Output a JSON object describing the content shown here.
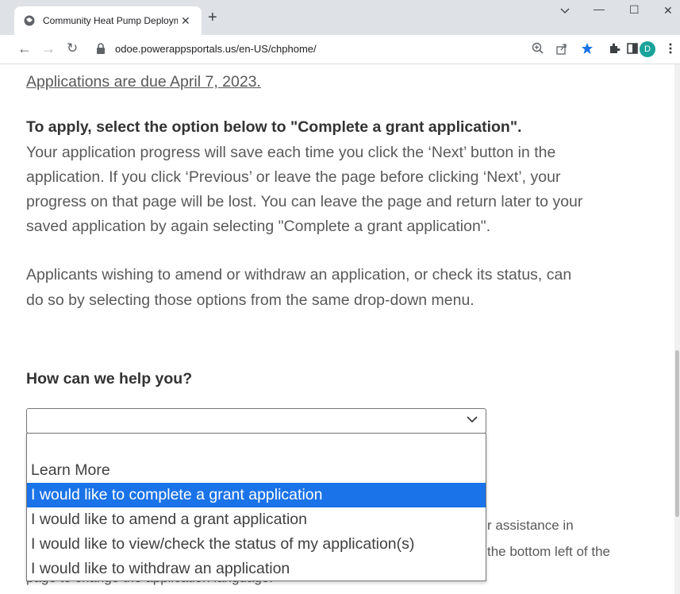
{
  "browser": {
    "tab_title": "Community Heat Pump Deploym",
    "tab_close": "✕",
    "new_tab": "+",
    "win_min": "—",
    "win_max": "☐",
    "win_close": "✕",
    "url": "odoe.powerappsportals.us/en-US/chphome/",
    "avatar_letter": "D"
  },
  "page": {
    "due_text": "Applications are due April 7, 2023.",
    "apply_heading": "To apply, select the option below to \"Complete a grant application\".",
    "apply_line1": "Your application progress will save each time you click the ‘Next’ button in the",
    "apply_line2": "application. If you click ‘Previous’ or leave the page before clicking ‘Next’, your",
    "apply_line3": "progress on that page will be lost. You can leave the page and return later to your",
    "apply_line4": "saved application by again selecting \"Complete a grant application\".",
    "amend_line1": "Applicants wishing to amend or withdraw an application, or check its status, can",
    "amend_line2": "do so by selecting those options from the same drop-down menu.",
    "help_heading": "How can we help you?",
    "bg_fragment1": "r assistance in",
    "bg_fragment2": "the bottom left of the",
    "bg_fragment3": "page to change the application language."
  },
  "dropdown": {
    "selected_value": "",
    "options": [
      "",
      "Learn More",
      "I would like to complete a grant application",
      "I would like to amend a grant application",
      "I would like to view/check the status of my application(s)",
      "I would like to withdraw an application"
    ],
    "highlighted_index": 2
  },
  "colors": {
    "highlight": "#1a73e8",
    "avatar": "#1aa39a",
    "star": "#1a73e8"
  }
}
